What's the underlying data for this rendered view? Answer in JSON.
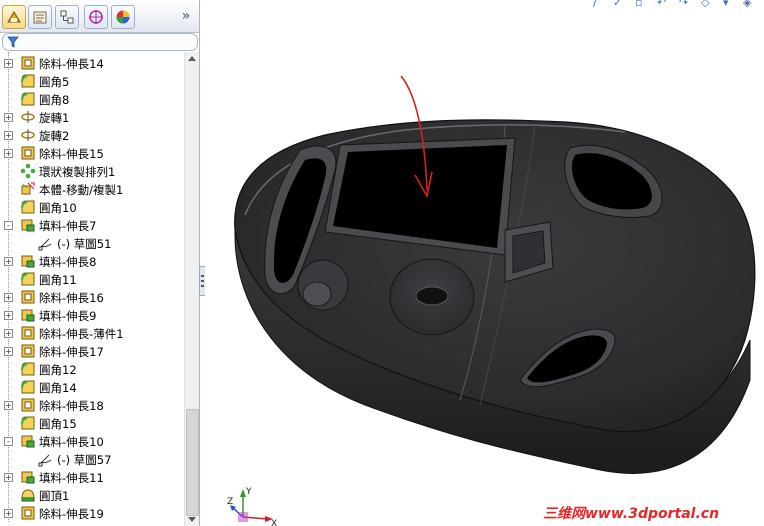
{
  "panel": {
    "tabs": [
      {
        "name": "feature-manager-tab",
        "icon": "feature-tree-icon",
        "active": true
      },
      {
        "name": "property-manager-tab",
        "icon": "property-manager-icon"
      },
      {
        "name": "configuration-manager-tab",
        "icon": "configuration-manager-icon"
      },
      {
        "name": "dimxpert-manager-tab",
        "icon": "dimxpert-icon"
      },
      {
        "name": "display-manager-tab",
        "icon": "display-manager-icon"
      }
    ],
    "more": "»",
    "filter_icon": "filter-icon"
  },
  "tree": {
    "items": [
      {
        "label": "除料-伸長14",
        "icon": "cut-extrude-icon",
        "expander": "+",
        "indent": 0
      },
      {
        "label": "圓角5",
        "icon": "fillet-icon",
        "expander": "",
        "indent": 0
      },
      {
        "label": "圓角8",
        "icon": "fillet-icon",
        "expander": "",
        "indent": 0
      },
      {
        "label": "旋轉1",
        "icon": "revolve-icon",
        "expander": "+",
        "indent": 0
      },
      {
        "label": "旋轉2",
        "icon": "revolve-icon",
        "expander": "+",
        "indent": 0
      },
      {
        "label": "除料-伸長15",
        "icon": "cut-extrude-icon",
        "expander": "+",
        "indent": 0
      },
      {
        "label": "環狀複製排列1",
        "icon": "circular-pattern-icon",
        "expander": "",
        "indent": 0
      },
      {
        "label": "本體-移動/複製1",
        "icon": "move-copy-body-icon",
        "expander": "",
        "indent": 0
      },
      {
        "label": "圓角10",
        "icon": "fillet-icon",
        "expander": "",
        "indent": 0
      },
      {
        "label": "填料-伸長7",
        "icon": "boss-extrude-icon",
        "expander": "-",
        "indent": 0
      },
      {
        "label": "(-) 草圖51",
        "icon": "sketch-icon",
        "expander": "",
        "indent": 1
      },
      {
        "label": "填料-伸長8",
        "icon": "boss-extrude-icon",
        "expander": "+",
        "indent": 0
      },
      {
        "label": "圓角11",
        "icon": "fillet-icon",
        "expander": "",
        "indent": 0
      },
      {
        "label": "除料-伸長16",
        "icon": "cut-extrude-icon",
        "expander": "+",
        "indent": 0
      },
      {
        "label": "填料-伸長9",
        "icon": "boss-extrude-icon",
        "expander": "+",
        "indent": 0
      },
      {
        "label": "除料-伸長-薄件1",
        "icon": "cut-extrude-icon",
        "expander": "+",
        "indent": 0
      },
      {
        "label": "除料-伸長17",
        "icon": "cut-extrude-icon",
        "expander": "+",
        "indent": 0
      },
      {
        "label": "圓角12",
        "icon": "fillet-icon",
        "expander": "",
        "indent": 0
      },
      {
        "label": "圓角14",
        "icon": "fillet-icon",
        "expander": "",
        "indent": 0
      },
      {
        "label": "除料-伸長18",
        "icon": "cut-extrude-icon",
        "expander": "+",
        "indent": 0
      },
      {
        "label": "圓角15",
        "icon": "fillet-icon",
        "expander": "",
        "indent": 0
      },
      {
        "label": "填料-伸長10",
        "icon": "boss-extrude-icon",
        "expander": "-",
        "indent": 0
      },
      {
        "label": "(-) 草圖57",
        "icon": "sketch-icon",
        "expander": "",
        "indent": 1
      },
      {
        "label": "填料-伸長11",
        "icon": "boss-extrude-icon",
        "expander": "+",
        "indent": 0
      },
      {
        "label": "圓頂1",
        "icon": "dome-icon",
        "expander": "",
        "indent": 0
      },
      {
        "label": "除料-伸長19",
        "icon": "cut-extrude-icon",
        "expander": "+",
        "indent": 0
      }
    ]
  },
  "viewport": {
    "model": "mouse-shell-model",
    "annotation": "red-arrow-icon",
    "triad": {
      "x": "X",
      "y": "Y",
      "z": "Z"
    },
    "watermark": "三维网www.3dportal.cn",
    "colors": {
      "model": "#2e2e30",
      "highlight": "#4a4a4e",
      "opening": "#000000",
      "arrow": "#d81f1f",
      "watermark": "#e52727"
    }
  }
}
